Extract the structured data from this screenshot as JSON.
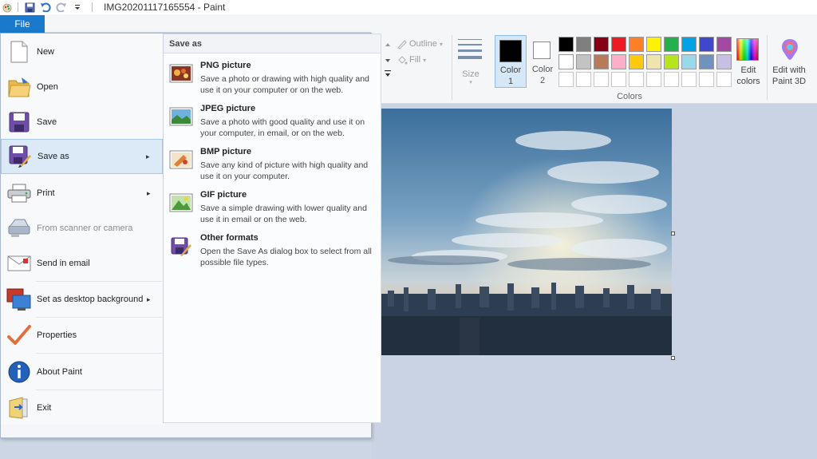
{
  "title": {
    "text": "IMG20201117165554 - Paint",
    "qa_undo": "undo",
    "qa_redo": "redo"
  },
  "file_tab": {
    "label": "File"
  },
  "file_menu": {
    "items": [
      {
        "label": "New",
        "icon": "new-file-icon"
      },
      {
        "label": "Open",
        "icon": "open-folder-icon"
      },
      {
        "label": "Save",
        "icon": "save-disk-icon"
      },
      {
        "label": "Save as",
        "icon": "save-as-icon"
      },
      {
        "label": "Print",
        "icon": "printer-icon"
      },
      {
        "label": "From scanner or camera",
        "icon": "scanner-icon"
      },
      {
        "label": "Send in email",
        "icon": "email-icon"
      },
      {
        "label": "Set as desktop background",
        "icon": "desktop-background-icon"
      },
      {
        "label": "Properties",
        "icon": "checkmark-icon"
      },
      {
        "label": "About Paint",
        "icon": "info-icon"
      },
      {
        "label": "Exit",
        "icon": "exit-icon"
      }
    ],
    "submenu": {
      "header": "Save as",
      "items": [
        {
          "title": "PNG picture",
          "desc": "Save a photo or drawing with high quality and use it on your computer or on the web."
        },
        {
          "title": "JPEG picture",
          "desc": "Save a photo with good quality and use it on your computer, in email, or on the web."
        },
        {
          "title": "BMP picture",
          "desc": "Save any kind of picture with high quality and use it on your computer."
        },
        {
          "title": "GIF picture",
          "desc": "Save a simple drawing with lower quality and use it in email or on the web."
        },
        {
          "title": "Other formats",
          "desc": "Open the Save As dialog box to select from all possible file types."
        }
      ]
    }
  },
  "ribbon": {
    "outline_label": "Outline",
    "fill_label": "Fill",
    "size_label": "Size",
    "color1_label": "Color",
    "color1_num": "1",
    "color2_label": "Color",
    "color2_num": "2",
    "colors_group": "Colors",
    "edit_colors_line1": "Edit",
    "edit_colors_line2": "colors",
    "edit_paint3d_line1": "Edit with",
    "edit_paint3d_line2": "Paint 3D",
    "color1_value": "#000000",
    "color2_value": "#ffffff",
    "palette_row1": [
      "#000000",
      "#7f7f7f",
      "#880015",
      "#ed1c24",
      "#ff7f27",
      "#fff200",
      "#22b14c",
      "#00a2e8",
      "#3f48cc",
      "#a349a4"
    ],
    "palette_row2": [
      "#ffffff",
      "#c3c3c3",
      "#b97a57",
      "#ffaec9",
      "#ffc90e",
      "#efe4b0",
      "#b5e61d",
      "#99d9ea",
      "#7092be",
      "#c8bfe7"
    ]
  }
}
